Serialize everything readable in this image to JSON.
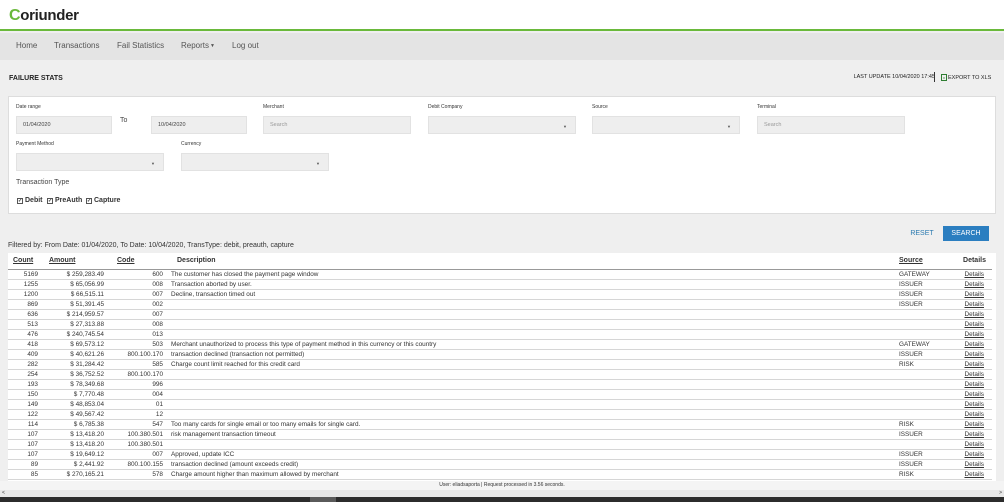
{
  "app": {
    "logo_c": "C",
    "logo_rest": "oriunder"
  },
  "nav": {
    "items": [
      "Home",
      "Transactions",
      "Fail Statistics",
      "Reports",
      "Log out"
    ],
    "reports_caret": "▼"
  },
  "header": {
    "title": "FAILURE STATS",
    "last_update": "LAST UPDATE 10/04/2020 17:45",
    "export_label": "EXPORT TO XLS"
  },
  "filters": {
    "date_range_label": "Date range",
    "date_from": "01/04/2020",
    "to_label": "To",
    "date_to": "10/04/2020",
    "merchant_label": "Merchant",
    "merchant_placeholder": "Search",
    "debit_company_label": "Debit Company",
    "source_label": "Source",
    "terminal_label": "Terminal",
    "terminal_placeholder": "Search",
    "payment_method_label": "Payment Method",
    "currency_label": "Currency",
    "transaction_type_label": "Transaction Type",
    "checkboxes": [
      "Debit",
      "PreAuth",
      "Capture"
    ],
    "check_mark": "✓"
  },
  "actions": {
    "reset": "RESET",
    "search": "SEARCH"
  },
  "filtered_by": "Filtered by: From Date: 01/04/2020, To Date: 10/04/2020, TransType: debit, preauth, capture",
  "table": {
    "headers": [
      "Count",
      "Amount",
      "Code",
      "Description",
      "Source",
      "Details"
    ],
    "rows": [
      [
        "5169",
        "$ 259,283.49",
        "600",
        "The customer has closed the payment page window",
        "GATEWAY",
        "Details"
      ],
      [
        "1255",
        "$ 65,056.99",
        "008",
        "Transaction aborted by user.",
        "ISSUER",
        "Details"
      ],
      [
        "1200",
        "$ 66,515.11",
        "007",
        "Decline, transaction timed out",
        "ISSUER",
        "Details"
      ],
      [
        "869",
        "$ 51,391.45",
        "002",
        "",
        "ISSUER",
        "Details"
      ],
      [
        "636",
        "$ 214,959.57",
        "007",
        "",
        "",
        "Details"
      ],
      [
        "513",
        "$ 27,313.88",
        "008",
        "",
        "",
        "Details"
      ],
      [
        "476",
        "$ 240,745.54",
        "013",
        "",
        "",
        "Details"
      ],
      [
        "418",
        "$ 69,573.12",
        "503",
        "Merchant unauthorized to process this type of payment method in this currency or this country",
        "GATEWAY",
        "Details"
      ],
      [
        "409",
        "$ 40,621.26",
        "800.100.170",
        "transaction declined (transaction not permitted)",
        "ISSUER",
        "Details"
      ],
      [
        "282",
        "$ 31,284.42",
        "585",
        "Charge count limit reached for this credit card",
        "RISK",
        "Details"
      ],
      [
        "254",
        "$ 36,752.52",
        "800.100.170",
        "",
        "",
        "Details"
      ],
      [
        "193",
        "$ 78,349.68",
        "996",
        "",
        "",
        "Details"
      ],
      [
        "150",
        "$ 7,770.48",
        "004",
        "",
        "",
        "Details"
      ],
      [
        "149",
        "$ 48,853.04",
        "01",
        "",
        "",
        "Details"
      ],
      [
        "122",
        "$ 49,567.42",
        "12",
        "",
        "",
        "Details"
      ],
      [
        "114",
        "$ 6,785.38",
        "547",
        "Too many cards for single email or too many emails for single card.",
        "RISK",
        "Details"
      ],
      [
        "107",
        "$ 13,418.20",
        "100.380.501",
        "risk management transaction timeout",
        "ISSUER",
        "Details"
      ],
      [
        "107",
        "$ 13,418.20",
        "100.380.501",
        "",
        "",
        "Details"
      ],
      [
        "107",
        "$ 19,649.12",
        "007",
        "Approved, update ICC",
        "ISSUER",
        "Details"
      ],
      [
        "89",
        "$ 2,441.92",
        "800.100.155",
        "transaction declined (amount exceeds credit)",
        "ISSUER",
        "Details"
      ],
      [
        "85",
        "$ 270,165.21",
        "578",
        "Charge amount higher than maximum allowed by merchant",
        "RISK",
        "Details"
      ]
    ]
  },
  "status_bar": "User: eliadsaporta   |   Request processed in 3.56 seconds.",
  "scroll": {
    "left_arrow": "<",
    "right_arrow": ">"
  }
}
